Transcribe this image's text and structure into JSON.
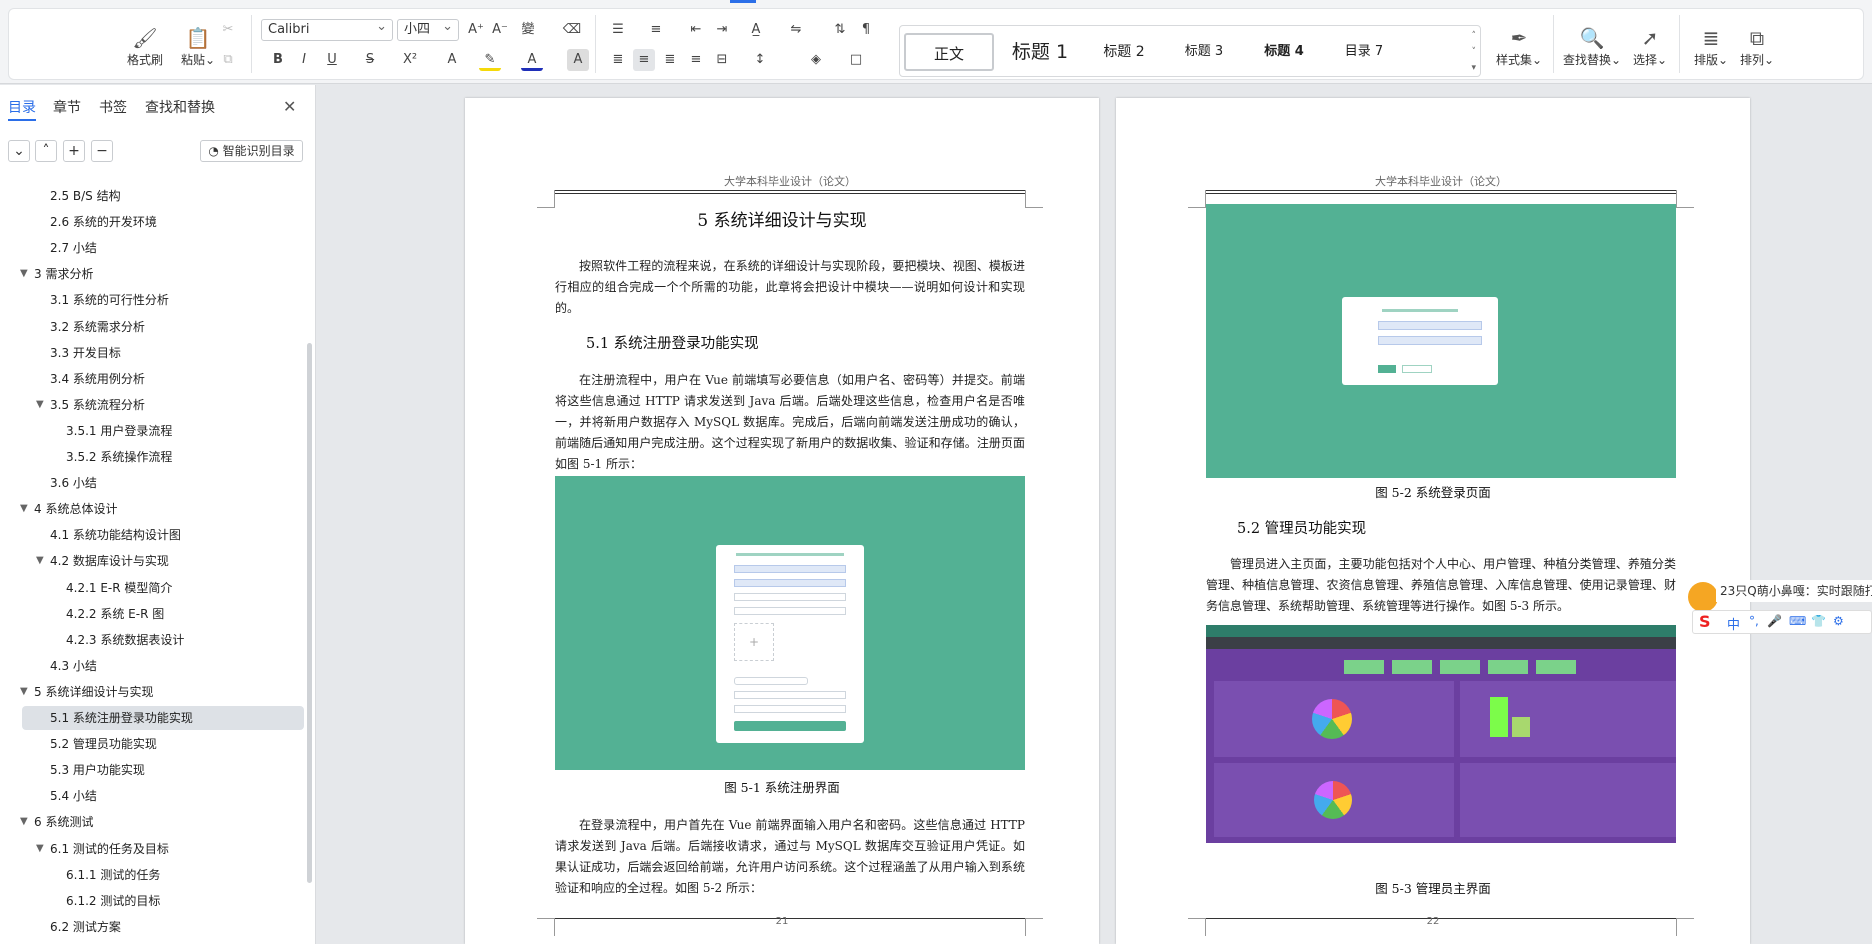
{
  "toolbar": {
    "clipboard": {
      "format_painter": "格式刷",
      "paste": "粘贴"
    },
    "font_name": "Calibri",
    "font_size": "小四",
    "styles": [
      "正文",
      "标题 1",
      "标题 2",
      "标题 3",
      "标题 4",
      "目录 7"
    ],
    "style_set": "样式集",
    "find_replace": "查找替换",
    "select": "选择",
    "typesetting": "排版",
    "arrange": "排列"
  },
  "sidebar": {
    "tabs": [
      "目录",
      "章节",
      "书签",
      "查找和替换"
    ],
    "smart_toc": "智能识别目录",
    "items": [
      {
        "label": "2.5 B/S 结构",
        "level": 2
      },
      {
        "label": "2.6 系统的开发环境",
        "level": 2
      },
      {
        "label": "2.7 小结",
        "level": 2
      },
      {
        "label": "3  需求分析",
        "level": 1
      },
      {
        "label": "3.1 系统的可行性分析",
        "level": 2
      },
      {
        "label": "3.2 系统需求分析",
        "level": 2
      },
      {
        "label": "3.3 开发目标",
        "level": 2
      },
      {
        "label": "3.4  系统用例分析",
        "level": 2
      },
      {
        "label": "3.5 系统流程分析",
        "level": 2,
        "expanded": true
      },
      {
        "label": "3.5.1  用户登录流程",
        "level": 3
      },
      {
        "label": "3.5.2  系统操作流程",
        "level": 3
      },
      {
        "label": "3.6 小结",
        "level": 2
      },
      {
        "label": "4  系统总体设计",
        "level": 1
      },
      {
        "label": "4.1 系统功能结构设计图",
        "level": 2
      },
      {
        "label": "4.2  数据库设计与实现",
        "level": 2,
        "expanded": true
      },
      {
        "label": "4.2.1    E-R 模型简介",
        "level": 3
      },
      {
        "label": "4.2.2    系统 E-R 图",
        "level": 3
      },
      {
        "label": "4.2.3  系统数据表设计",
        "level": 3
      },
      {
        "label": "4.3 小结",
        "level": 2
      },
      {
        "label": "5  系统详细设计与实现",
        "level": 1
      },
      {
        "label": "5.1 系统注册登录功能实现",
        "level": 2,
        "active": true
      },
      {
        "label": "5.2 管理员功能实现",
        "level": 2
      },
      {
        "label": "5.3 用户功能实现",
        "level": 2
      },
      {
        "label": "5.4  小结",
        "level": 2
      },
      {
        "label": "6  系统测试",
        "level": 1
      },
      {
        "label": "6.1  测试的任务及目标",
        "level": 2,
        "expanded": true
      },
      {
        "label": "6.1.1    测试的任务",
        "level": 3
      },
      {
        "label": "6.1.2    测试的目标",
        "level": 3
      },
      {
        "label": "6.2    测试方案",
        "level": 2
      }
    ]
  },
  "page_left": {
    "header": "大学本科毕业设计（论文）",
    "title": "5  系统详细设计与实现",
    "para1": "按照软件工程的流程来说，在系统的详细设计与实现阶段，要把模块、视图、模板进行相应的组合完成一个个所需的功能，此章将会把设计中模块——说明如何设计和实现的。",
    "sec51": "5.1 系统注册登录功能实现",
    "para2": "在注册流程中，用户在 Vue 前端填写必要信息（如用户名、密码等）并提交。前端将这些信息通过 HTTP 请求发送到 Java 后端。后端处理这些信息，检查用户名是否唯一，并将新用户数据存入 MySQL 数据库。完成后，后端向前端发送注册成功的确认，前端随后通知用户完成注册。这个过程实现了新用户的数据收集、验证和存储。注册页面如图 5-1 所示：",
    "fig1_caption": "图 5-1  系统注册界面",
    "para3": "在登录流程中，用户首先在 Vue 前端界面输入用户名和密码。这些信息通过 HTTP 请求发送到 Java 后端。后端接收请求，通过与 MySQL 数据库交互验证用户凭证。如果认证成功，后端会返回给前端，允许用户访问系统。这个过程涵盖了从用户输入到系统验证和响应的全过程。如图 5-2 所示：",
    "page_number": "21"
  },
  "page_right": {
    "header": "大学本科毕业设计（论文）",
    "fig2_caption": "图 5-2 系统登录页面",
    "sec52": "5.2 管理员功能实现",
    "para1": "管理员进入主页面，主要功能包括对个人中心、用户管理、种植分类管理、养殖分类管理、种植信息管理、农资信息管理、养殖信息管理、入库信息管理、使用记录管理、财务信息管理、系统帮助管理、系统管理等进行操作。如图 5-3 所示。",
    "fig3_caption": "图 5-3  管理员主界面",
    "page_number": "22"
  },
  "ime": {
    "notice": "23只Q萌小鼻嘎：实时跟随打",
    "mode": "中"
  },
  "colors": {
    "accent": "#2b6ee8",
    "screenshot_green": "#53b194",
    "dashboard_purple": "#6b3fa0"
  }
}
